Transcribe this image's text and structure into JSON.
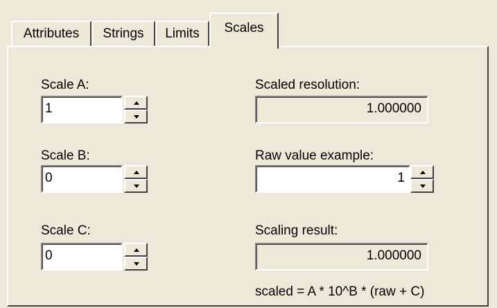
{
  "tabs": [
    {
      "label": "Attributes"
    },
    {
      "label": "Strings"
    },
    {
      "label": "Limits"
    },
    {
      "label": "Scales"
    }
  ],
  "active_tab": "Scales",
  "left": {
    "scale_a": {
      "label": "Scale A:",
      "value": "1"
    },
    "scale_b": {
      "label": "Scale B:",
      "value": "0"
    },
    "scale_c": {
      "label": "Scale C:",
      "value": "0"
    }
  },
  "right": {
    "scaled_resolution": {
      "label": "Scaled resolution:",
      "value": "1.000000"
    },
    "raw_value_example": {
      "label": "Raw value example:",
      "value": "1"
    },
    "scaling_result": {
      "label": "Scaling result:",
      "value": "1.000000"
    },
    "formula": "scaled = A * 10^B * (raw + C)"
  },
  "icons": {
    "spin_up": "spin-up-arrow-icon",
    "spin_down": "spin-down-arrow-icon"
  }
}
